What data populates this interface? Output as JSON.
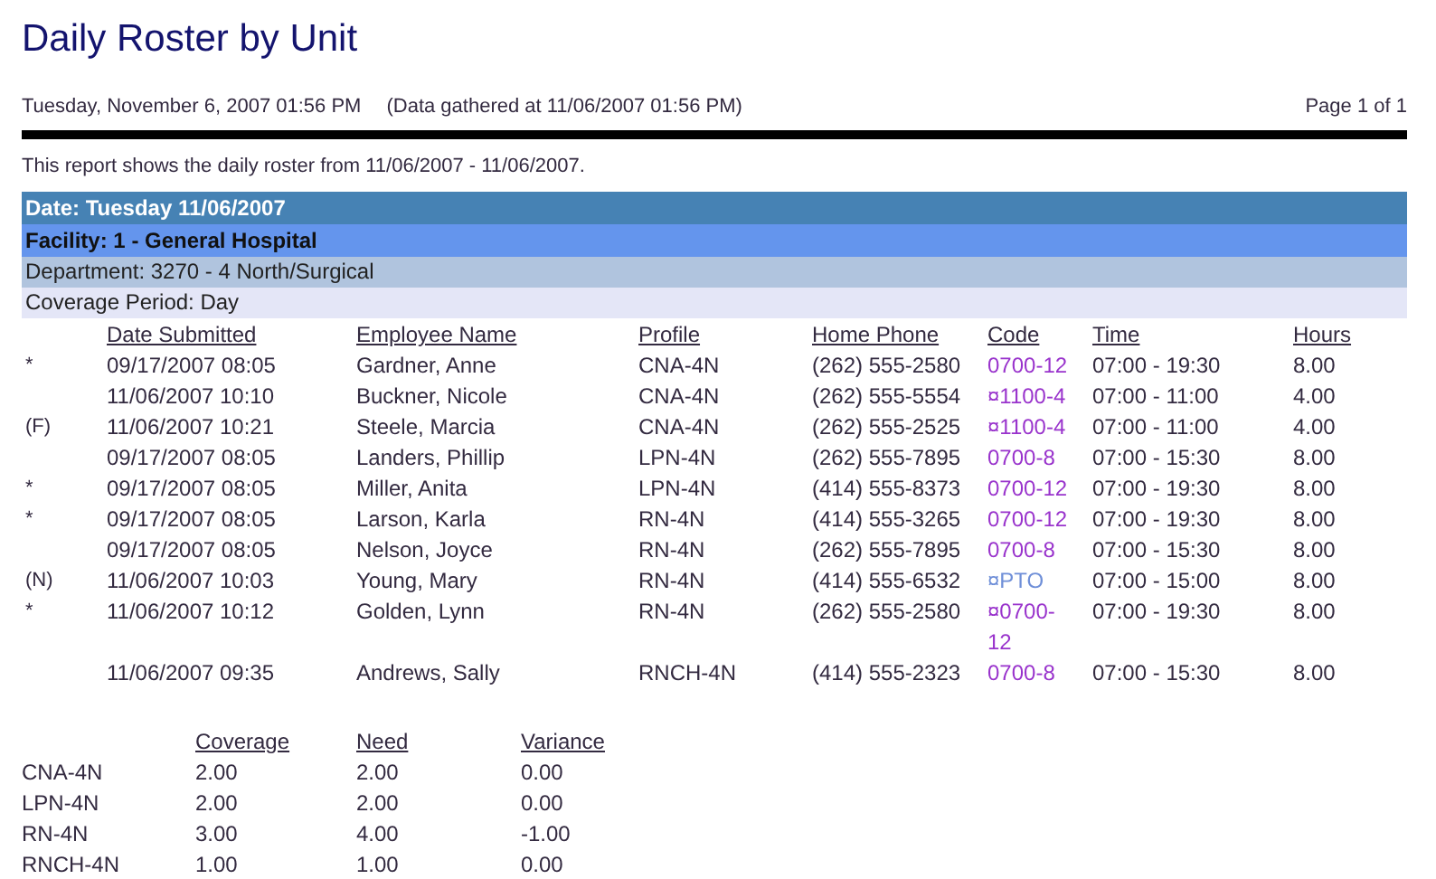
{
  "report": {
    "title": "Daily Roster by Unit",
    "printed_at": "Tuesday, November 6, 2007 01:56 PM",
    "gathered": "(Data gathered at 11/06/2007 01:56 PM)",
    "page": "Page 1 of 1",
    "description": "This report shows the daily roster from 11/06/2007 - 11/06/2007."
  },
  "groups": {
    "date": "Date: Tuesday 11/06/2007",
    "facility": "Facility: 1 - General Hospital",
    "department": "Department: 3270 - 4 North/Surgical",
    "period": "Coverage Period: Day"
  },
  "roster": {
    "columns": [
      "Date Submitted",
      "Employee Name",
      "Profile",
      "Home Phone",
      "Code",
      "Time",
      "Hours"
    ],
    "rows": [
      {
        "flag": "*",
        "date": "09/17/2007 08:05",
        "name": "Gardner, Anne",
        "profile": "CNA-4N",
        "phone": "(262) 555-2580",
        "code": "0700-12",
        "color": "#9933cc",
        "time": "07:00 - 19:30",
        "hours": "8.00"
      },
      {
        "date": "11/06/2007 10:10",
        "name": "Buckner, Nicole",
        "profile": "CNA-4N",
        "phone": "(262) 555-5554",
        "code": "¤1100-4",
        "color": "#9933cc",
        "time": "07:00 - 11:00",
        "hours": "4.00"
      },
      {
        "flag": "(F)",
        "date": "11/06/2007 10:21",
        "name": "Steele, Marcia",
        "profile": "CNA-4N",
        "phone": "(262) 555-2525",
        "code": "¤1100-4",
        "color": "#9933cc",
        "time": "07:00 - 11:00",
        "hours": "4.00"
      },
      {
        "date": "09/17/2007 08:05",
        "name": "Landers, Phillip",
        "profile": "LPN-4N",
        "phone": "(262) 555-7895",
        "code": "0700-8",
        "color": "#9933cc",
        "time": "07:00 - 15:30",
        "hours": "8.00"
      },
      {
        "flag": "*",
        "date": "09/17/2007 08:05",
        "name": "Miller, Anita",
        "profile": "LPN-4N",
        "phone": "(414) 555-8373",
        "code": "0700-12",
        "color": "#9933cc",
        "time": "07:00 - 19:30",
        "hours": "8.00"
      },
      {
        "flag": "*",
        "date": "09/17/2007 08:05",
        "name": "Larson, Karla",
        "profile": "RN-4N",
        "phone": "(414) 555-3265",
        "code": "0700-12",
        "color": "#9933cc",
        "time": "07:00 - 19:30",
        "hours": "8.00"
      },
      {
        "date": "09/17/2007 08:05",
        "name": "Nelson, Joyce",
        "profile": "RN-4N",
        "phone": "(262) 555-7895",
        "code": "0700-8",
        "color": "#9933cc",
        "time": "07:00 - 15:30",
        "hours": "8.00"
      },
      {
        "flag": "(N)",
        "date": "11/06/2007 10:03",
        "name": "Young, Mary",
        "profile": "RN-4N",
        "phone": "(414) 555-6532",
        "code": "¤PTO",
        "color": "#6f8fd8",
        "time": "07:00 - 15:00",
        "hours": "8.00"
      },
      {
        "flag": "*",
        "date": "11/06/2007 10:12",
        "name": "Golden, Lynn",
        "profile": "RN-4N",
        "phone": "(262) 555-2580",
        "code": "¤0700-12",
        "color": "#9933cc",
        "time": "07:00 - 19:30",
        "hours": "8.00"
      },
      {
        "date": "11/06/2007 09:35",
        "name": "Andrews, Sally",
        "profile": "RNCH-4N",
        "phone": "(414) 555-2323",
        "code": "0700-8",
        "color": "#9933cc",
        "time": "07:00 - 15:30",
        "hours": "8.00"
      }
    ]
  },
  "summary": {
    "columns": [
      "Coverage",
      "Need",
      "Variance"
    ],
    "rows": [
      {
        "profile": "CNA-4N",
        "coverage": "2.00",
        "need": "2.00",
        "variance": "0.00"
      },
      {
        "profile": "LPN-4N",
        "coverage": "2.00",
        "need": "2.00",
        "variance": "0.00"
      },
      {
        "profile": "RN-4N",
        "coverage": "3.00",
        "need": "4.00",
        "variance": "-1.00"
      },
      {
        "profile": "RNCH-4N",
        "coverage": "1.00",
        "need": "1.00",
        "variance": "0.00"
      }
    ]
  }
}
